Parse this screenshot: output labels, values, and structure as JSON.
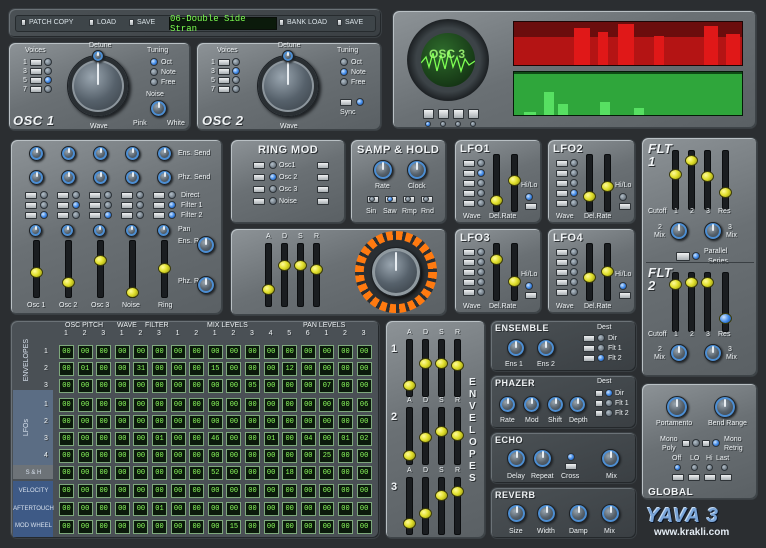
{
  "top_bar": {
    "patch_copy": "PATCH COPY",
    "load": "LOAD",
    "save": "SAVE",
    "patch_name": "06-Double Side Stran",
    "bank_load": "BANK LOAD",
    "bank_save": "SAVE"
  },
  "osc1": {
    "title": "OSC 1",
    "voices_label": "Voices",
    "voices": [
      "1",
      "3",
      "5",
      "7"
    ],
    "detune_label": "Detune",
    "wave_label": "Wave",
    "tuning_label": "Tuning",
    "tuning_options": [
      "Oct",
      "Note",
      "Free"
    ],
    "noise_label": "Noise",
    "pink_label": "Pink",
    "white_label": "White"
  },
  "osc2": {
    "title": "OSC 2",
    "voices_label": "Voices",
    "voices": [
      "1",
      "3",
      "5",
      "7"
    ],
    "detune_label": "Detune",
    "wave_label": "Wave",
    "tuning_label": "Tuning",
    "tuning_options": [
      "Oct",
      "Note",
      "Free"
    ],
    "sync_label": "Sync"
  },
  "scope": {
    "label": "OSC 3"
  },
  "mixer": {
    "ens_send": "Ens. Send",
    "phz_send": "Phz. Send",
    "direct": "Direct",
    "filter1": "Filter 1",
    "filter2": "Filter 2",
    "pan": "Pan",
    "ens_ret": "Ens. Ret",
    "phz_ret": "Phz. Ret",
    "channels": [
      "Osc 1",
      "Osc 2",
      "Osc 3",
      "Noise",
      "Ring"
    ]
  },
  "ring_mod": {
    "title": "RING MOD",
    "options": [
      "Osc1",
      "Osc 2",
      "Osc 3",
      "Noise"
    ]
  },
  "samp_hold": {
    "title": "SAMP & HOLD",
    "rate": "Rate",
    "clock": "Clock",
    "modes": [
      "Sin",
      "Saw",
      "Rmp",
      "Rnd"
    ]
  },
  "lfos": [
    {
      "title": "LFO1",
      "wave": "Wave",
      "rate": "Del.Rate",
      "hilo": "Hi/Lo"
    },
    {
      "title": "LFO2",
      "wave": "Wave",
      "rate": "Del.Rate",
      "hilo": "Hi/Lo"
    },
    {
      "title": "LFO3",
      "wave": "Wave",
      "rate": "Del.Rate",
      "hilo": "Hi/Lo"
    },
    {
      "title": "LFO4",
      "wave": "Wave",
      "rate": "Del.Rate",
      "hilo": "Hi/Lo"
    }
  ],
  "amp_env": {
    "letters": [
      "A",
      "D",
      "S",
      "R"
    ]
  },
  "filters": {
    "flt1": "FLT 1",
    "flt2": "FLT 2",
    "cutoff": "Cutoff",
    "nums": [
      "1",
      "2",
      "3"
    ],
    "res": "Res",
    "mix": "Mix",
    "parallel": "Parallel",
    "series": "Series"
  },
  "matrix": {
    "headers": {
      "osc_pitch": "OSC PITCH",
      "wave": "WAVE",
      "filter": "FILTER",
      "mix_levels": "MIX LEVELS",
      "pan_levels": "PAN LEVELS"
    },
    "column_numbers": [
      "1",
      "2",
      "3",
      "1",
      "2",
      "3",
      "1",
      "2",
      "1",
      "2",
      "3",
      "4",
      "5",
      "6",
      "1",
      "2",
      "3"
    ],
    "row_groups": [
      "ENVELOPES",
      "LFOs",
      "S & H",
      "VELOCITY",
      "AFTERTOUCH",
      "MOD WHEEL"
    ],
    "row_numbers": [
      "1",
      "2",
      "3",
      "1",
      "2",
      "3",
      "4"
    ],
    "rows": [
      [
        "00",
        "00",
        "00",
        "00",
        "00",
        "00",
        "00",
        "00",
        "00",
        "00",
        "00",
        "00",
        "00",
        "00",
        "00",
        "00",
        "00"
      ],
      [
        "00",
        "01",
        "00",
        "00",
        "31",
        "00",
        "00",
        "00",
        "15",
        "00",
        "00",
        "00",
        "12",
        "00",
        "00",
        "00",
        "00"
      ],
      [
        "00",
        "00",
        "00",
        "00",
        "00",
        "00",
        "00",
        "00",
        "00",
        "00",
        "05",
        "00",
        "00",
        "00",
        "07",
        "00",
        "00"
      ],
      [
        "00",
        "00",
        "00",
        "00",
        "00",
        "00",
        "00",
        "00",
        "00",
        "00",
        "00",
        "00",
        "00",
        "00",
        "00",
        "00",
        "06"
      ],
      [
        "00",
        "00",
        "00",
        "00",
        "00",
        "00",
        "00",
        "00",
        "00",
        "00",
        "00",
        "00",
        "00",
        "00",
        "00",
        "00",
        "00"
      ],
      [
        "00",
        "00",
        "00",
        "00",
        "00",
        "01",
        "00",
        "00",
        "46",
        "00",
        "00",
        "01",
        "00",
        "04",
        "00",
        "01",
        "02"
      ],
      [
        "00",
        "00",
        "00",
        "00",
        "00",
        "00",
        "00",
        "00",
        "00",
        "00",
        "00",
        "00",
        "00",
        "00",
        "25",
        "00",
        "00"
      ],
      [
        "00",
        "00",
        "00",
        "00",
        "00",
        "00",
        "00",
        "00",
        "52",
        "00",
        "00",
        "00",
        "18",
        "00",
        "00",
        "00",
        "00"
      ],
      [
        "00",
        "00",
        "00",
        "00",
        "00",
        "00",
        "00",
        "00",
        "00",
        "00",
        "00",
        "00",
        "00",
        "00",
        "00",
        "00",
        "00"
      ],
      [
        "00",
        "00",
        "00",
        "00",
        "00",
        "01",
        "00",
        "00",
        "00",
        "00",
        "00",
        "00",
        "00",
        "00",
        "00",
        "00",
        "00"
      ],
      [
        "00",
        "00",
        "00",
        "00",
        "00",
        "00",
        "00",
        "00",
        "00",
        "15",
        "00",
        "00",
        "00",
        "00",
        "00",
        "00",
        "00"
      ]
    ]
  },
  "envelopes": {
    "title": "ENVELOPES",
    "letters": [
      "A",
      "D",
      "S",
      "R"
    ],
    "numbers": [
      "1",
      "2",
      "3"
    ]
  },
  "ensemble": {
    "title": "ENSEMBLE",
    "knobs": [
      "Ens 1",
      "Ens 2"
    ],
    "dest_label": "Dest",
    "dest": [
      "Dir",
      "Flt 1",
      "Flt 2"
    ]
  },
  "phazer": {
    "title": "PHAZER",
    "knobs": [
      "Rate",
      "Mod",
      "Shift",
      "Depth"
    ],
    "dest_label": "Dest",
    "dest": [
      "Dir",
      "Flt 1",
      "Flt 2"
    ]
  },
  "echo": {
    "title": "ECHO",
    "knobs": [
      "Delay",
      "Repeat",
      "Cross",
      "Mix"
    ]
  },
  "reverb": {
    "title": "REVERB",
    "knobs": [
      "Size",
      "Width",
      "Damp",
      "Mix"
    ]
  },
  "global": {
    "title": "GLOBAL",
    "portamento": "Portamento",
    "bend_range": "Bend Range",
    "mono": "Mono",
    "poly": "Poly",
    "mono_retrig": "Mono",
    "retrig": "Retrig",
    "modes": [
      "Off",
      "LO",
      "Hi",
      "Last"
    ]
  },
  "brand": {
    "logo": "YAVA 3",
    "url": "www.krakli.com"
  },
  "colors": {
    "led_on": "#3c86e6",
    "lcd_text": "#7dff52",
    "fader_cap": "#e1e02c",
    "meter_red": "#e01818",
    "meter_green": "#2fcf3f"
  }
}
